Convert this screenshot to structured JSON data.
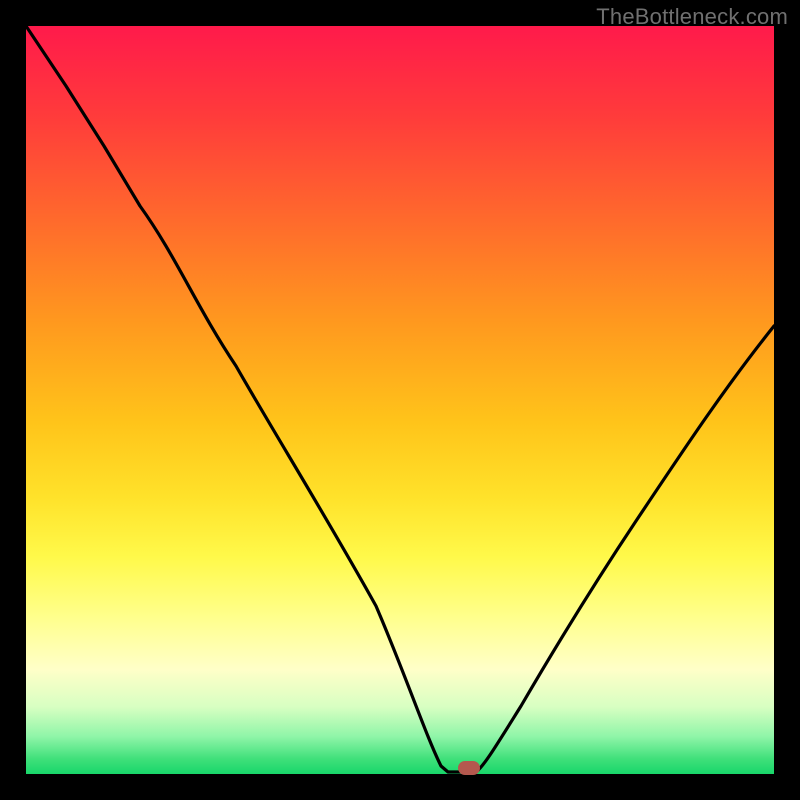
{
  "watermark": "TheBottleneck.com",
  "colors": {
    "page_bg": "#000000",
    "curve_stroke": "#000000",
    "marker_fill": "#B4584E",
    "watermark_text": "#707070"
  },
  "chart_data": {
    "type": "line",
    "title": "",
    "xlabel": "",
    "ylabel": "",
    "xlim": [
      0,
      100
    ],
    "ylim": [
      0,
      100
    ],
    "grid": false,
    "legend": false,
    "background": "vertical gradient red-orange-yellow-green (bottleneck heat scale)",
    "note": "Axes are unlabeled; values estimated from pixel positions on a 0-100 normalized grid. Higher y ≈ worse bottleneck (red), y≈0 ≈ no bottleneck (green). Curve reaches y≈0 (flat) near x≈55-60.",
    "series": [
      {
        "name": "bottleneck-curve",
        "x": [
          0,
          5,
          10,
          15,
          20,
          25,
          30,
          35,
          40,
          45,
          50,
          54,
          56,
          58,
          60,
          62,
          65,
          70,
          75,
          80,
          85,
          90,
          95,
          100
        ],
        "y": [
          100,
          92,
          84,
          76,
          70,
          64,
          56,
          48,
          39,
          29,
          18,
          6,
          1,
          0,
          0,
          1,
          5,
          13,
          21,
          29,
          37,
          45,
          53,
          60
        ]
      }
    ],
    "marker": {
      "name": "optimal-point",
      "x": 59,
      "y": 0
    }
  }
}
